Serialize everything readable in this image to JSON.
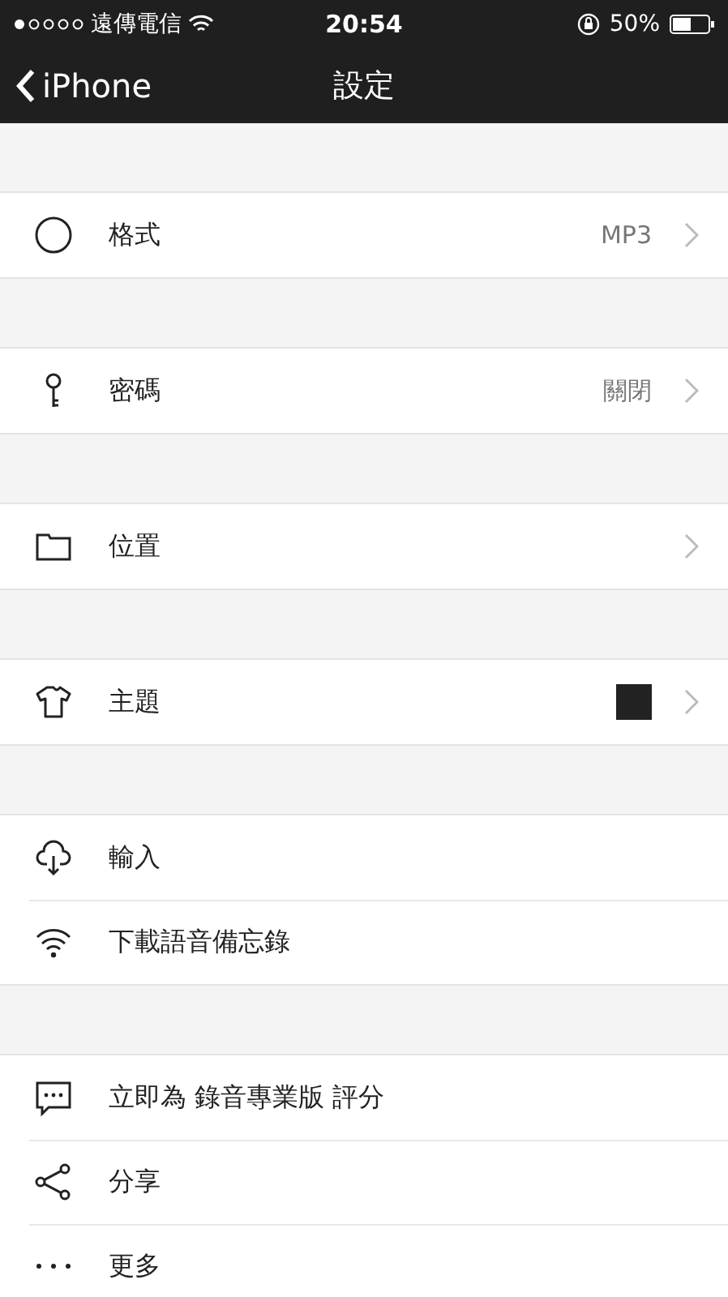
{
  "status_bar": {
    "carrier": "遠傳電信",
    "time": "20:54",
    "battery": "50%"
  },
  "nav_bar": {
    "back": "iPhone",
    "title": "設定"
  },
  "sections": [
    {
      "items": [
        {
          "kind": "circle",
          "label": "格式",
          "value": "MP3",
          "chevron": true
        }
      ]
    },
    {
      "items": [
        {
          "kind": "key",
          "label": "密碼",
          "value": "關閉",
          "chevron": true
        }
      ]
    },
    {
      "items": [
        {
          "kind": "folder",
          "label": "位置",
          "chevron": true
        }
      ]
    },
    {
      "items": [
        {
          "kind": "shirt",
          "label": "主題",
          "color": "#222222",
          "chevron": true
        }
      ]
    },
    {
      "items": [
        {
          "kind": "cloud",
          "label": "輸入",
          "chevron": false
        },
        {
          "kind": "wifi",
          "label": "下載語音備忘錄",
          "chevron": false
        }
      ]
    },
    {
      "items": [
        {
          "kind": "chat",
          "label": "立即為 錄音專業版 評分",
          "chevron": false
        },
        {
          "kind": "share",
          "label": "分享",
          "chevron": false
        },
        {
          "kind": "dots",
          "label": "更多",
          "chevron": false
        }
      ]
    }
  ]
}
